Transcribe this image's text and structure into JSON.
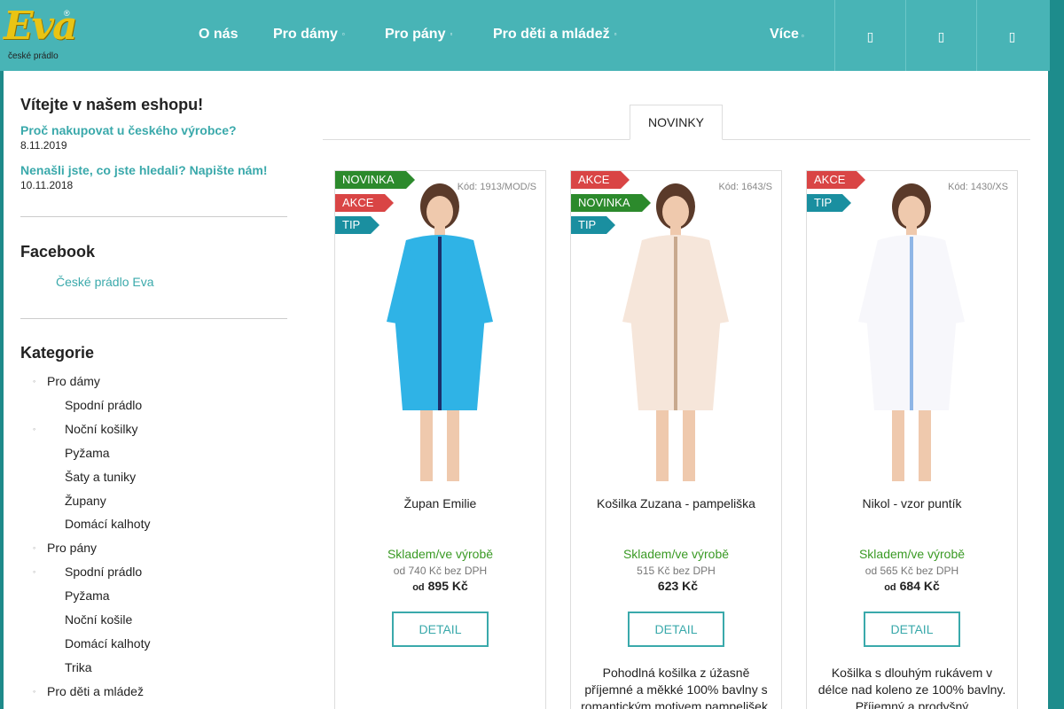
{
  "brand": {
    "name": "Eva",
    "registered": "®",
    "tagline": "české prádlo",
    "script_color": "#e9c414"
  },
  "nav": {
    "items": [
      {
        "label": "O nás",
        "has_submenu": false
      },
      {
        "label": "Pro dámy",
        "has_submenu": true
      },
      {
        "label": "Pro pány",
        "has_submenu": true
      },
      {
        "label": "Pro děti a mládež",
        "has_submenu": true
      }
    ],
    "more": "Více",
    "caret": "▫",
    "icon_buttons": [
      "search-icon",
      "user-icon",
      "cart-icon"
    ],
    "icon_glyph": "▯"
  },
  "sidebar": {
    "welcome_title": "Vítejte v našem eshopu!",
    "news": [
      {
        "title": "Proč nakupovat u českého výrobce?",
        "date": "8.11.2019"
      },
      {
        "title": "Nenašli jste, co jste hledali? Napište nám!",
        "date": "10.11.2018"
      }
    ],
    "facebook_title": "Facebook",
    "facebook_link": "České prádlo Eva",
    "categories_title": "Kategorie",
    "bullet": "◦",
    "categories": [
      {
        "label": "Pro dámy",
        "level": 0,
        "bullet": true
      },
      {
        "label": "Spodní prádlo",
        "level": 1,
        "bullet": false
      },
      {
        "label": "Noční košilky",
        "level": 1,
        "bullet": true
      },
      {
        "label": "Pyžama",
        "level": 1,
        "bullet": false
      },
      {
        "label": "Šaty a tuniky",
        "level": 1,
        "bullet": false
      },
      {
        "label": "Župany",
        "level": 1,
        "bullet": false
      },
      {
        "label": "Domácí kalhoty",
        "level": 1,
        "bullet": false
      },
      {
        "label": "Pro pány",
        "level": 0,
        "bullet": true
      },
      {
        "label": "Spodní prádlo",
        "level": 1,
        "bullet": true
      },
      {
        "label": "Pyžama",
        "level": 1,
        "bullet": false
      },
      {
        "label": "Noční košile",
        "level": 1,
        "bullet": false
      },
      {
        "label": "Domácí kalhoty",
        "level": 1,
        "bullet": false
      },
      {
        "label": "Trika",
        "level": 1,
        "bullet": false
      },
      {
        "label": "Pro děti a mládež",
        "level": 0,
        "bullet": true
      }
    ]
  },
  "tabs": {
    "active": "NOVINKY"
  },
  "products": [
    {
      "name": "Župan Emilie",
      "code": "Kód: 1913/MOD/S",
      "flags": [
        "NOVINKA",
        "AKCE",
        "TIP"
      ],
      "stock": "Skladem/ve výrobě",
      "price_net": "od 740 Kč bez DPH",
      "price_prefix": "od",
      "price": "895 Kč",
      "detail": "DETAIL",
      "desc": "",
      "garment_color": "#2fb3e6",
      "trim_color": "#1b2f6b"
    },
    {
      "name": "Košilka Zuzana - pampeliška",
      "code": "Kód: 1643/S",
      "flags": [
        "AKCE",
        "NOVINKA",
        "TIP"
      ],
      "stock": "Skladem/ve výrobě",
      "price_net": "515 Kč bez DPH",
      "price_prefix": "",
      "price": "623 Kč",
      "detail": "DETAIL",
      "desc": "Pohodlná košilka z úžasně příjemné a měkké 100% bavlny s romantickým motivem pampelišek.",
      "garment_color": "#f6e6da",
      "trim_color": "#c8a98e"
    },
    {
      "name": "Nikol - vzor puntík",
      "code": "Kód: 1430/XS",
      "flags": [
        "AKCE",
        "TIP"
      ],
      "stock": "Skladem/ve výrobě",
      "price_net": "od 565 Kč bez DPH",
      "price_prefix": "od",
      "price": "684 Kč",
      "detail": "DETAIL",
      "desc": "Košilka s  dlouhým rukávem v délce nad koleno ze 100% bavlny. Příjemný a prodyšný",
      "garment_color": "#f7f7fb",
      "trim_color": "#8fb6e6"
    }
  ]
}
